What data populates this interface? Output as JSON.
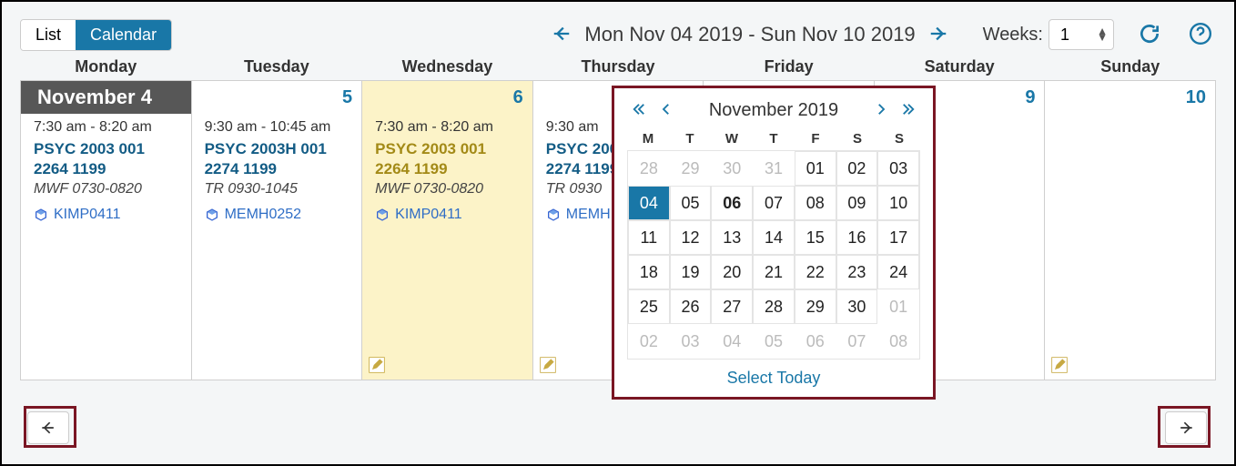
{
  "view_toggle": {
    "list": "List",
    "calendar": "Calendar",
    "active": "calendar"
  },
  "toolbar": {
    "date_range": "Mon Nov 04 2019 - Sun Nov 10 2019",
    "weeks_label": "Weeks:",
    "weeks_value": "1"
  },
  "week": {
    "days": [
      {
        "name": "Monday",
        "num_label": "November 4",
        "selected": true,
        "highlight": false,
        "event": {
          "time": "7:30 am - 8:20 am",
          "code": "PSYC 2003 001 2264 1199",
          "sched": "MWF 0730-0820",
          "loc": "KIMP0411"
        },
        "has_edit_icon": false
      },
      {
        "name": "Tuesday",
        "num_label": "5",
        "selected": false,
        "highlight": false,
        "event": {
          "time": "9:30 am - 10:45 am",
          "code": "PSYC 2003H 001 2274 1199",
          "sched": "TR 0930-1045",
          "loc": "MEMH0252"
        },
        "has_edit_icon": false
      },
      {
        "name": "Wednesday",
        "num_label": "6",
        "selected": false,
        "highlight": true,
        "event": {
          "time": "7:30 am - 8:20 am",
          "code": "PSYC 2003 001 2264 1199",
          "sched": "MWF 0730-0820",
          "loc": "KIMP0411"
        },
        "has_edit_icon": true
      },
      {
        "name": "Thursday",
        "num_label": "",
        "selected": false,
        "highlight": false,
        "event": {
          "time": "9:30 am",
          "code": "PSYC 2003H 001 2274 1199",
          "sched": "TR 0930",
          "loc": "MEMH"
        },
        "has_edit_icon": true
      },
      {
        "name": "Friday",
        "num_label": "",
        "selected": false,
        "highlight": false,
        "event": null,
        "has_edit_icon": false
      },
      {
        "name": "Saturday",
        "num_label": "9",
        "selected": false,
        "highlight": false,
        "event": null,
        "has_edit_icon": true
      },
      {
        "name": "Sunday",
        "num_label": "10",
        "selected": false,
        "highlight": false,
        "event": null,
        "has_edit_icon": true
      }
    ]
  },
  "mini_cal": {
    "title": "November 2019",
    "dow": [
      "M",
      "T",
      "W",
      "T",
      "F",
      "S",
      "S"
    ],
    "rows": [
      [
        {
          "n": "28",
          "out": true
        },
        {
          "n": "29",
          "out": true
        },
        {
          "n": "30",
          "out": true
        },
        {
          "n": "31",
          "out": true
        },
        {
          "n": "01"
        },
        {
          "n": "02"
        },
        {
          "n": "03"
        }
      ],
      [
        {
          "n": "04",
          "sel": true
        },
        {
          "n": "05"
        },
        {
          "n": "06",
          "today": true
        },
        {
          "n": "07"
        },
        {
          "n": "08"
        },
        {
          "n": "09"
        },
        {
          "n": "10"
        }
      ],
      [
        {
          "n": "11"
        },
        {
          "n": "12"
        },
        {
          "n": "13"
        },
        {
          "n": "14"
        },
        {
          "n": "15"
        },
        {
          "n": "16"
        },
        {
          "n": "17"
        }
      ],
      [
        {
          "n": "18"
        },
        {
          "n": "19"
        },
        {
          "n": "20"
        },
        {
          "n": "21"
        },
        {
          "n": "22"
        },
        {
          "n": "23"
        },
        {
          "n": "24"
        }
      ],
      [
        {
          "n": "25"
        },
        {
          "n": "26"
        },
        {
          "n": "27"
        },
        {
          "n": "28"
        },
        {
          "n": "29"
        },
        {
          "n": "30"
        },
        {
          "n": "01",
          "out": true
        }
      ],
      [
        {
          "n": "02",
          "out": true
        },
        {
          "n": "03",
          "out": true
        },
        {
          "n": "04",
          "out": true
        },
        {
          "n": "05",
          "out": true
        },
        {
          "n": "06",
          "out": true
        },
        {
          "n": "07",
          "out": true
        },
        {
          "n": "08",
          "out": true
        }
      ]
    ],
    "select_today": "Select Today"
  }
}
